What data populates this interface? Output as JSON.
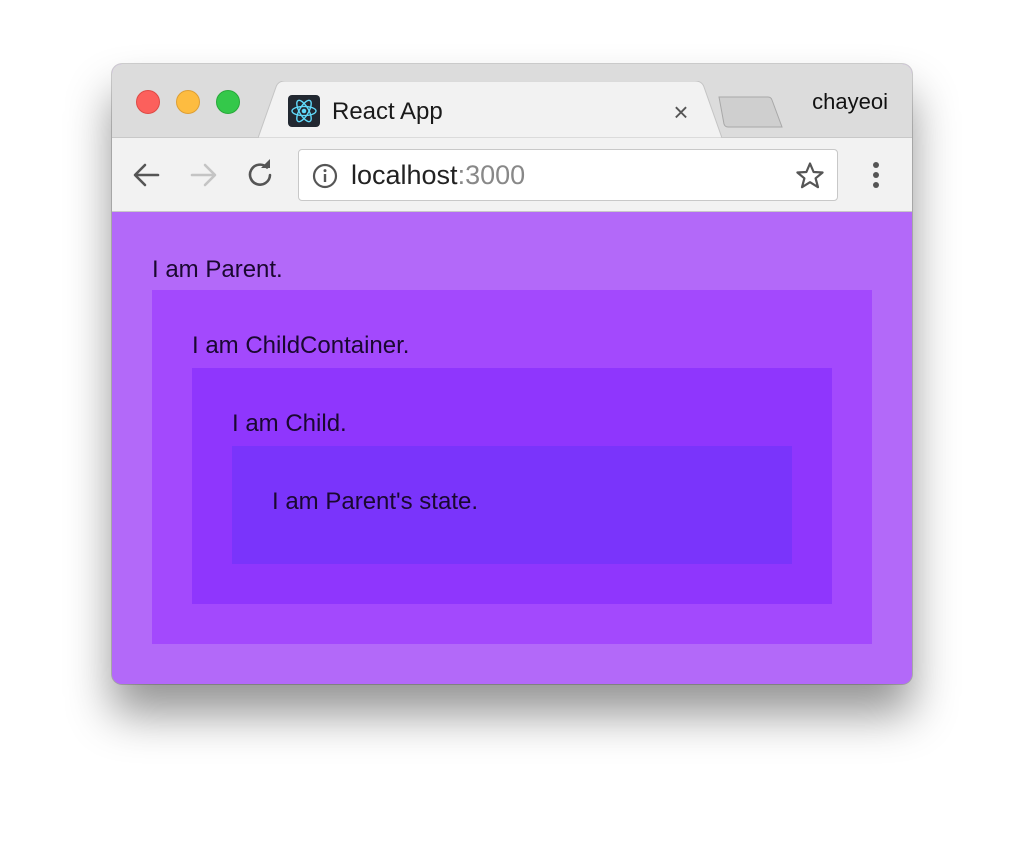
{
  "browser": {
    "tab": {
      "title": "React App",
      "close_glyph": "×",
      "favicon": "react-logo-icon"
    },
    "profile_name": "chayeoi",
    "address_bar": {
      "host": "localhost",
      "port": ":3000"
    },
    "colors": {
      "traffic_close": "#fc605c",
      "traffic_minimize": "#fdbc40",
      "traffic_maximize": "#34c84a"
    }
  },
  "page": {
    "parent": {
      "label": "I am Parent.",
      "color": "#b369f9"
    },
    "child_container": {
      "label": "I am ChildContainer.",
      "color": "#a349fd"
    },
    "child": {
      "label": "I am Child.",
      "color": "#8f36fd"
    },
    "state": {
      "label": "I am Parent's state.",
      "color": "#7a34fb"
    }
  }
}
